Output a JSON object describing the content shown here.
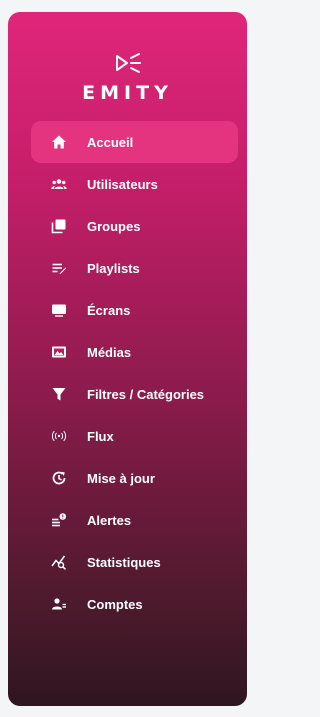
{
  "brand": {
    "name": "EMITY"
  },
  "nav": {
    "items": [
      {
        "label": "Accueil",
        "icon": "home-icon",
        "active": true
      },
      {
        "label": "Utilisateurs",
        "icon": "users-icon"
      },
      {
        "label": "Groupes",
        "icon": "groups-icon"
      },
      {
        "label": "Playlists",
        "icon": "playlist-icon"
      },
      {
        "label": "Écrans",
        "icon": "screen-icon"
      },
      {
        "label": "Médias",
        "icon": "media-icon"
      },
      {
        "label": "Filtres / Catégories",
        "icon": "filter-icon"
      },
      {
        "label": "Flux",
        "icon": "broadcast-icon"
      },
      {
        "label": "Mise à jour",
        "icon": "update-icon"
      },
      {
        "label": "Alertes",
        "icon": "alert-icon"
      },
      {
        "label": "Statistiques",
        "icon": "stats-icon"
      },
      {
        "label": "Comptes",
        "icon": "accounts-icon"
      }
    ]
  },
  "colors": {
    "gradient_top": "#e0267a",
    "gradient_bottom": "#2e1620",
    "active_bg": "#e5347f",
    "text": "#ffffff"
  }
}
